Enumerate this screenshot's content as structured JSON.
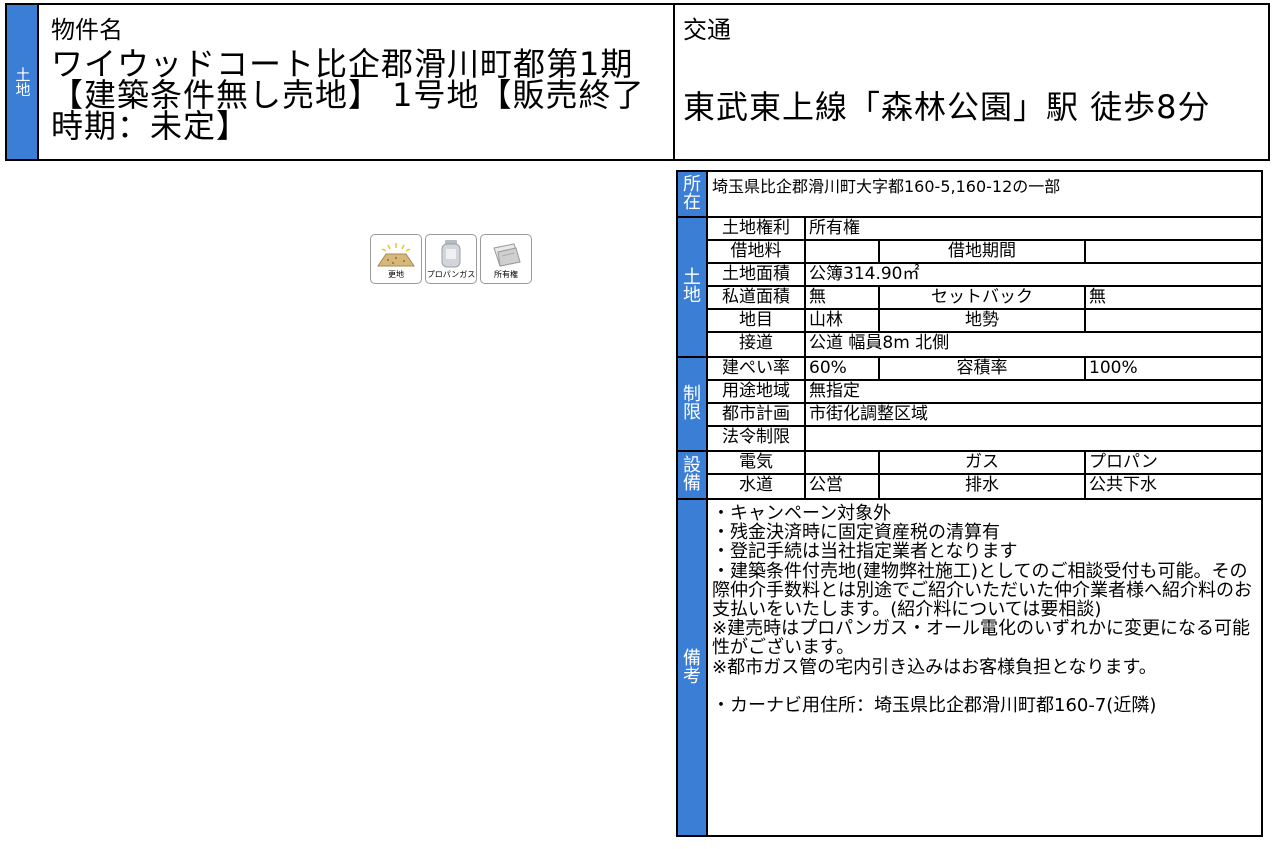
{
  "header": {
    "section_tab": "土地",
    "property_label": "物件名",
    "property_name": "ワイウッドコート比企郡滑川町都第1期【建築条件無し売地】 1号地【販売終了時期：未定】",
    "traffic_label": "交通",
    "traffic_value": "東武東上線「森林公園」駅 徒歩8分"
  },
  "icons": [
    {
      "name": "vacant-land-icon",
      "label": "更地"
    },
    {
      "name": "propane-gas-icon",
      "label": "プロパンガス"
    },
    {
      "name": "ownership-icon",
      "label": "所有権"
    }
  ],
  "detail": {
    "location": {
      "tab": "所在",
      "value": "埼玉県比企郡滑川町大字都160-5,160-12の一部"
    },
    "land": {
      "tab": "土地",
      "rows": [
        [
          "土地権利",
          "所有権"
        ],
        [
          "借地料",
          "",
          "借地期間",
          ""
        ],
        [
          "土地面積",
          "公簿314.90㎡"
        ],
        [
          "私道面積",
          "無",
          "セットバック",
          "無"
        ],
        [
          "地目",
          "山林",
          "地勢",
          ""
        ],
        [
          "接道",
          "公道 幅員8m 北側"
        ]
      ]
    },
    "restrictions": {
      "tab": "制限",
      "rows": [
        [
          "建ぺい率",
          "60%",
          "容積率",
          "100%"
        ],
        [
          "用途地域",
          "無指定"
        ],
        [
          "都市計画",
          "市街化調整区域"
        ],
        [
          "法令制限",
          ""
        ]
      ]
    },
    "facilities": {
      "tab": "設備",
      "rows": [
        [
          "電気",
          "",
          "ガス",
          "プロパン"
        ],
        [
          "水道",
          "公営",
          "排水",
          "公共下水"
        ]
      ]
    },
    "remarks": {
      "tab": "備考",
      "text": "・キャンペーン対象外\n・残金決済時に固定資産税の清算有\n・登記手続は当社指定業者となります\n・建築条件付売地(建物弊社施工)としてのご相談受付も可能。その際仲介手数料とは別途でご紹介いただいた仲介業者様へ紹介料のお支払いをいたします。(紹介料については要相談)\n※建売時はプロパンガス・オール電化のいずれかに変更になる可能性がございます。\n※都市ガス管の宅内引き込みはお客様負担となります。\n\n・カーナビ用住所：埼玉県比企郡滑川町都160-7(近隣)"
    }
  }
}
